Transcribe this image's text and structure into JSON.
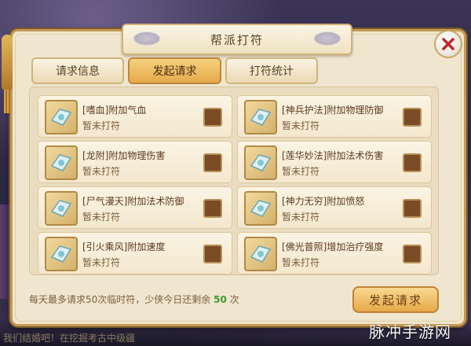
{
  "panel": {
    "title": "帮派打符",
    "close_icon": "close-x-icon"
  },
  "tabs": [
    {
      "label": "请求信息",
      "active": false
    },
    {
      "label": "发起请求",
      "active": true
    },
    {
      "label": "打符统计",
      "active": false
    }
  ],
  "items": [
    {
      "name": "[嗜血]附加气血",
      "status": "暂未打符",
      "checked": false
    },
    {
      "name": "[神兵护法]附加物理防御",
      "status": "暂未打符",
      "checked": false
    },
    {
      "name": "[龙附]附加物理伤害",
      "status": "暂未打符",
      "checked": false
    },
    {
      "name": "[莲华妙法]附加法术伤害",
      "status": "暂未打符",
      "checked": false
    },
    {
      "name": "[尸气漫天]附加法术防御",
      "status": "暂未打符",
      "checked": false
    },
    {
      "name": "[神力无穷]附加愤怒",
      "status": "暂未打符",
      "checked": false
    },
    {
      "name": "[引火乘风]附加速度",
      "status": "暂未打符",
      "checked": false
    },
    {
      "name": "[佛光普照]增加治疗强度",
      "status": "暂未打符",
      "checked": false
    }
  ],
  "footer": {
    "text": "每天最多请求50次临时符，少侠今日还剩余",
    "remaining": "50",
    "unit": "次",
    "send_label": "发起请求"
  },
  "chat": {
    "line": "我们结婚吧！在挖掘考古中级疆"
  },
  "watermark": "脉冲手游网",
  "colors": {
    "accent": "#e5a94a",
    "panel_bg": "#f0e6cf",
    "count_green": "#3f9a2f"
  }
}
